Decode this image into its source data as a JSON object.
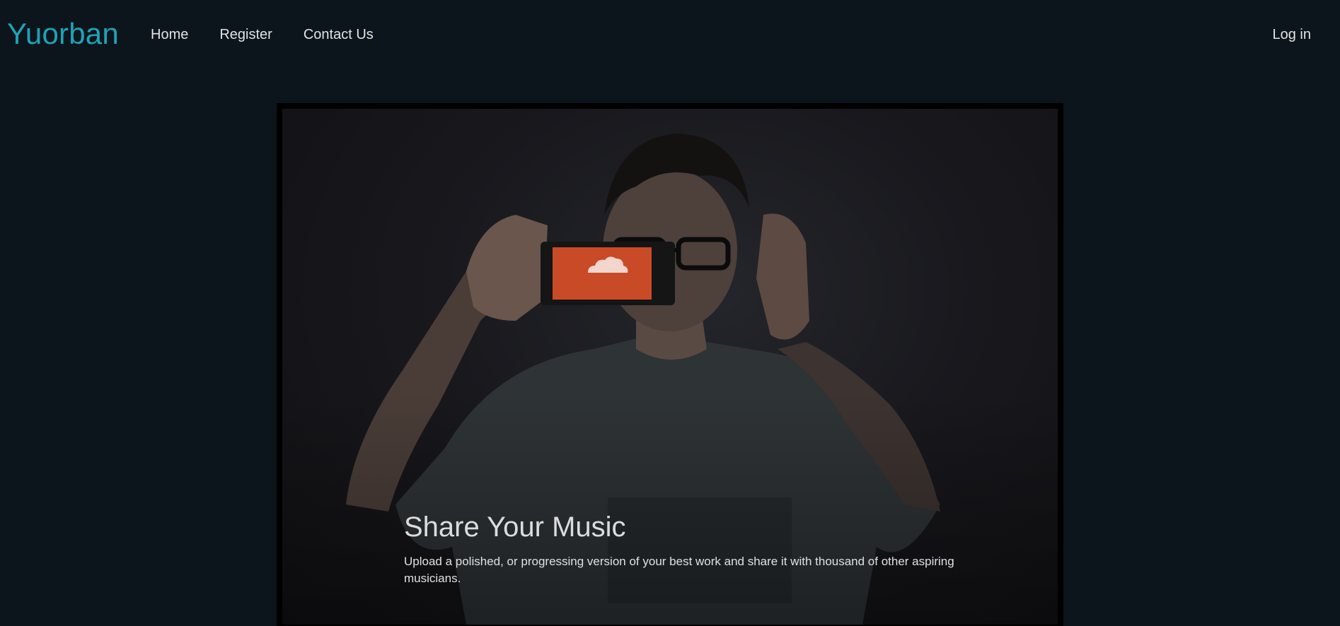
{
  "nav": {
    "brand": "Yuorban",
    "links": [
      {
        "label": "Home"
      },
      {
        "label": "Register"
      },
      {
        "label": "Contact Us"
      }
    ],
    "login": "Log in"
  },
  "hero": {
    "title": "Share Your Music",
    "text": "Upload a polished, or progressing version of your best work and share it with thousand of other aspiring musicians.",
    "phone_label": "SOUNDCLOUD"
  },
  "colors": {
    "background": "#0c151c",
    "brand": "#1fa3b5",
    "phone_screen": "#c94a27"
  }
}
